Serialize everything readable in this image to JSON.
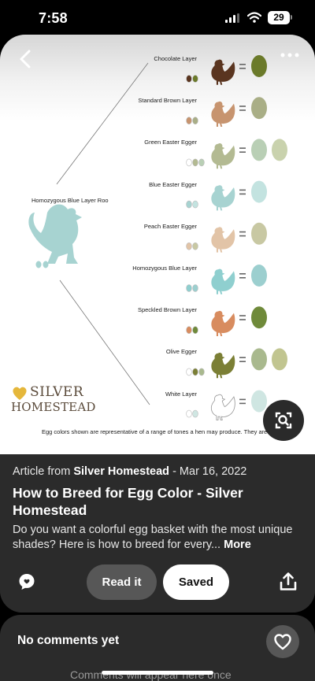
{
  "status_bar": {
    "time": "7:58",
    "battery": "29"
  },
  "pin": {
    "roo_label": "Homozygous Blue Layer Roo",
    "layers": [
      {
        "label": "Chocolate Layer",
        "hen_color": "#5a3520",
        "egg_colors": [
          "#6b7a2a"
        ]
      },
      {
        "label": "Standard Brown Layer",
        "hen_color": "#c7946f",
        "egg_colors": [
          "#a9ae86"
        ]
      },
      {
        "label": "Green Easter Egger",
        "hen_color": "#b3ba92",
        "egg_colors": [
          "#b9cfb5",
          "#c9d2ad"
        ]
      },
      {
        "label": "Blue Easter Egger",
        "hen_color": "#a7d3d1",
        "egg_colors": [
          "#c3e3e0"
        ]
      },
      {
        "label": "Peach Easter Egger",
        "hen_color": "#e2c4a7",
        "egg_colors": [
          "#c8c8a3"
        ]
      },
      {
        "label": "Homozygous Blue Layer",
        "hen_color": "#8fcfcf",
        "egg_colors": [
          "#9ccfcf"
        ]
      },
      {
        "label": "Speckled Brown Layer",
        "hen_color": "#d88c5f",
        "egg_colors": [
          "#6f8a3a"
        ]
      },
      {
        "label": "Olive Egger",
        "hen_color": "#7b7f35",
        "egg_colors": [
          "#a9b98e",
          "#c1c590"
        ]
      },
      {
        "label": "White Layer",
        "hen_color": "#ffffff",
        "egg_colors": [
          "#cfe6e2"
        ]
      }
    ],
    "logo_top": "SILVER",
    "logo_bottom": "HOMESTEAD",
    "disclaimer": "Egg colors shown are representative of a range of tones a hen may produce. They are not exact."
  },
  "article": {
    "prefix": "Article from ",
    "source": "Silver Homestead",
    "date": " - Mar 16, 2022",
    "title": "How to Breed for Egg Color - Silver Homestead",
    "description": "Do you want a colorful egg basket with the most unique shades? Here is how to breed for every...",
    "more_label": "More"
  },
  "actions": {
    "read_label": "Read it",
    "saved_label": "Saved"
  },
  "comments": {
    "empty_label": "No comments yet",
    "hint": "Comments will appear here once"
  },
  "icons": [
    "back-arrow-icon",
    "more-dots-icon",
    "visual-search-icon",
    "comment-icon",
    "share-icon",
    "heart-icon"
  ],
  "colors": {
    "roo": "#a7d3d1",
    "background": "#000000",
    "panel": "#2b2b2b",
    "button_grey": "#575757"
  }
}
